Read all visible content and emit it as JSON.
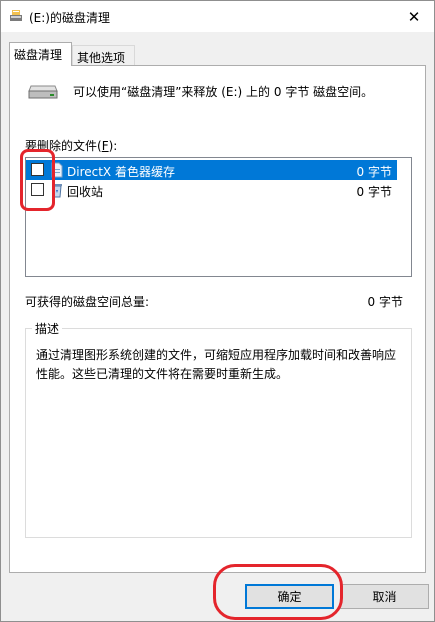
{
  "window": {
    "title": "(E:)的磁盘清理",
    "close_glyph": "✕"
  },
  "tabs": [
    {
      "label": "磁盘清理",
      "active": true
    },
    {
      "label": "其他选项",
      "active": false
    }
  ],
  "intro_text": "可以使用“磁盘清理”来释放 (E:) 上的 0 字节 磁盘空间。",
  "files": {
    "label_prefix": "要删除的文件(",
    "label_key": "F",
    "label_suffix": "):",
    "items": [
      {
        "name": "DirectX 着色器缓存",
        "size": "0 字节",
        "checked": false,
        "selected": true,
        "icon": "document-icon"
      },
      {
        "name": "回收站",
        "size": "0 字节",
        "checked": false,
        "selected": false,
        "icon": "recycle-bin-icon"
      }
    ]
  },
  "total": {
    "label": "可获得的磁盘空间总量:",
    "value": "0 字节"
  },
  "description": {
    "title": "描述",
    "text": "通过清理图形系统创建的文件，可缩短应用程序加载时间和改善响应性能。这些已清理的文件将在需要时重新生成。"
  },
  "buttons": {
    "ok": "确定",
    "cancel": "取消"
  },
  "colors": {
    "selection": "#0078d7",
    "annotation": "#e4252c"
  }
}
